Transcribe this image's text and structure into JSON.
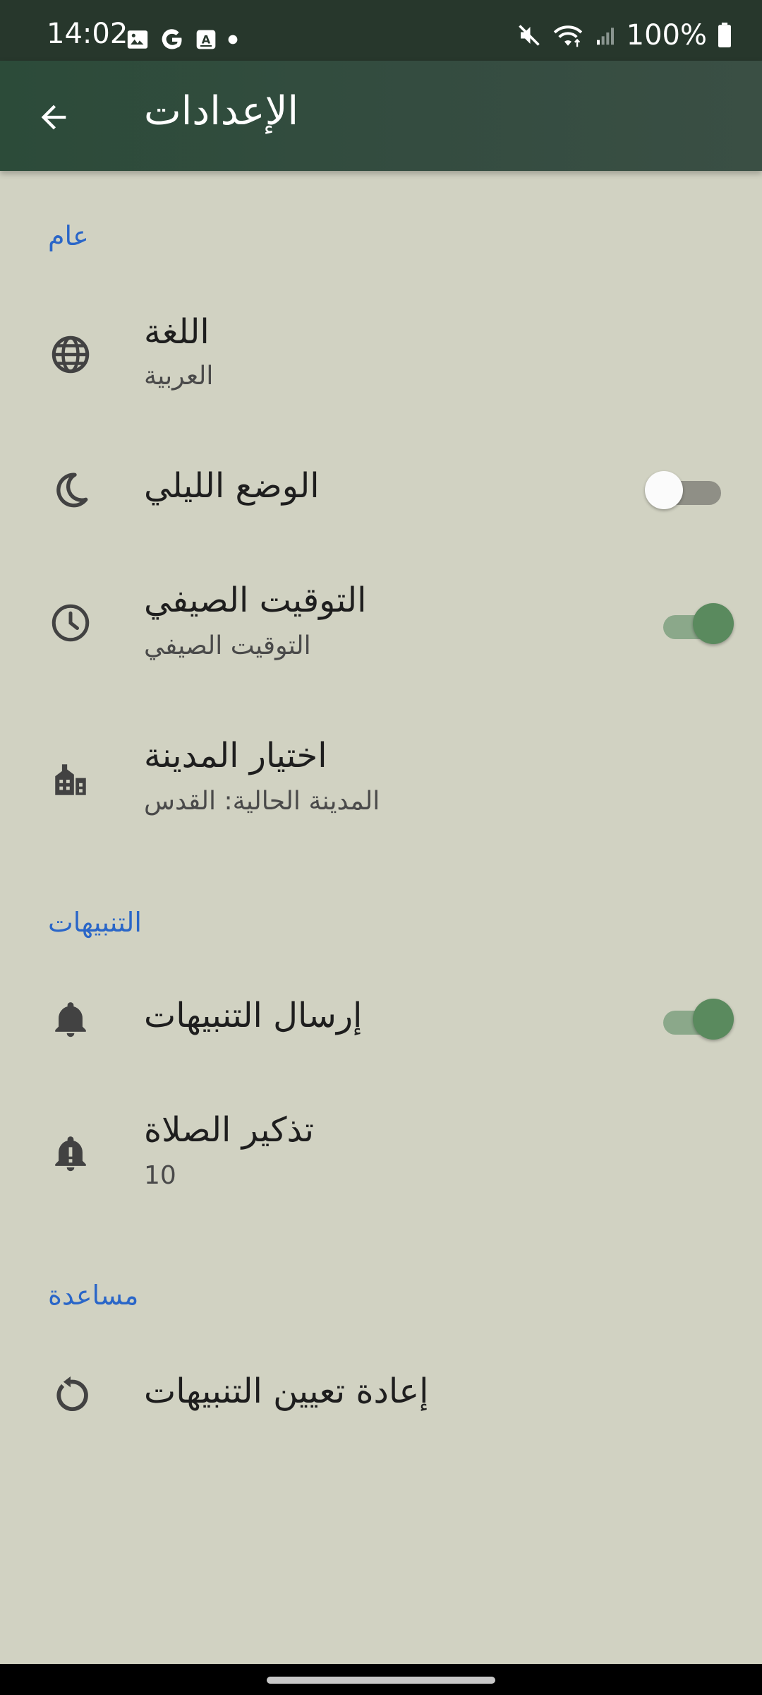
{
  "status_bar": {
    "time": "14:02",
    "battery_text": "100%",
    "icons_left": [
      "image-icon",
      "google-g-icon",
      "auto-text-icon",
      "dot-icon"
    ],
    "icons_right": [
      "mute-icon",
      "wifi-icon",
      "signal-icon",
      "battery-icon"
    ]
  },
  "app_bar": {
    "title": "الإعدادات",
    "back_icon": "arrow-left-icon"
  },
  "sections": {
    "general": "عام",
    "notifications": "التنبيهات",
    "help": "مساعدة"
  },
  "items": {
    "language": {
      "title": "اللغة",
      "summary": "العربية",
      "icon": "globe-icon"
    },
    "night_mode": {
      "title": "الوضع الليلي",
      "icon": "moon-icon",
      "enabled": false
    },
    "daylight_saving": {
      "title": "التوقيت الصيفي",
      "summary": "التوقيت الصيفي",
      "icon": "clock-icon",
      "enabled": true
    },
    "city": {
      "title": "اختيار المدينة",
      "summary": "المدينة الحالية: القدس",
      "icon": "city-icon"
    },
    "send_notifications": {
      "title": "إرسال التنبيهات",
      "icon": "bell-icon",
      "enabled": true
    },
    "prayer_reminder": {
      "title": "تذكير الصلاة",
      "summary": "10",
      "icon": "bell-alert-icon"
    },
    "reset_notifications": {
      "title": "إعادة تعيين التنبيهات",
      "icon": "reset-icon"
    }
  },
  "colors": {
    "app_bar": "#2c4b39",
    "status_bar": "#27372c",
    "background": "#d1d2c2",
    "section_header": "#2a66c8",
    "toggle_on": "#5a8a5e",
    "toggle_off": "#8f8f86"
  }
}
